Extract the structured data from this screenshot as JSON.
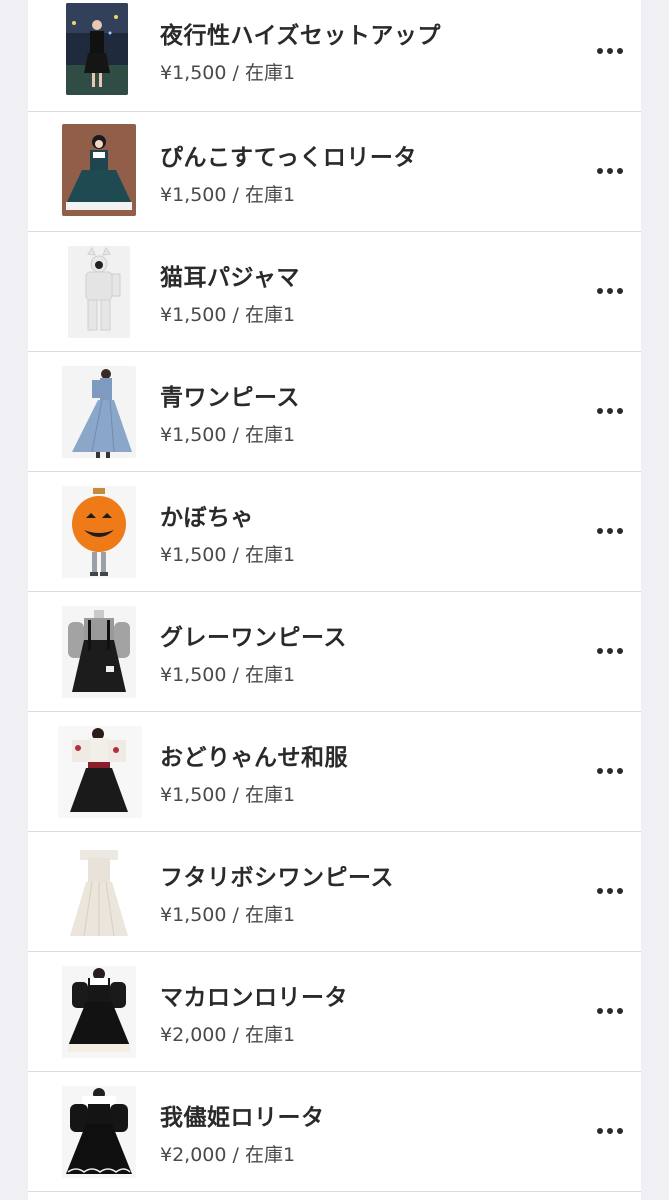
{
  "items": [
    {
      "name": "夜行性ハイズセットアップ",
      "price": "¥1,500",
      "separator": "/",
      "stock": "在庫1",
      "image": "night-city-outfit-photo"
    },
    {
      "name": "ぴんこすてっくロリータ",
      "price": "¥1,500",
      "separator": "/",
      "stock": "在庫1",
      "image": "green-lolita-dress-photo"
    },
    {
      "name": "猫耳パジャマ",
      "price": "¥1,500",
      "separator": "/",
      "stock": "在庫1",
      "image": "cat-ear-pajama-photo"
    },
    {
      "name": "青ワンピース",
      "price": "¥1,500",
      "separator": "/",
      "stock": "在庫1",
      "image": "blue-dress-photo"
    },
    {
      "name": "かぼちゃ",
      "price": "¥1,500",
      "separator": "/",
      "stock": "在庫1",
      "image": "pumpkin-costume-photo"
    },
    {
      "name": "グレーワンピース",
      "price": "¥1,500",
      "separator": "/",
      "stock": "在庫1",
      "image": "gray-dress-photo"
    },
    {
      "name": "おどりゃんせ和服",
      "price": "¥1,500",
      "separator": "/",
      "stock": "在庫1",
      "image": "kimono-dress-photo"
    },
    {
      "name": "フタリボシワンピース",
      "price": "¥1,500",
      "separator": "/",
      "stock": "在庫1",
      "image": "white-dress-photo"
    },
    {
      "name": "マカロンロリータ",
      "price": "¥2,000",
      "separator": "/",
      "stock": "在庫1",
      "image": "macaron-lolita-photo"
    },
    {
      "name": "我儘姫ロリータ",
      "price": "¥2,000",
      "separator": "/",
      "stock": "在庫1",
      "image": "black-princess-lolita-photo"
    }
  ],
  "colors": {
    "background": "#efeff4",
    "card": "#ffffff",
    "title": "#2a2a2a",
    "meta": "#4a4a4a",
    "divider": "#dcdce0"
  },
  "icons": {
    "more": "more-horizontal-icon"
  }
}
